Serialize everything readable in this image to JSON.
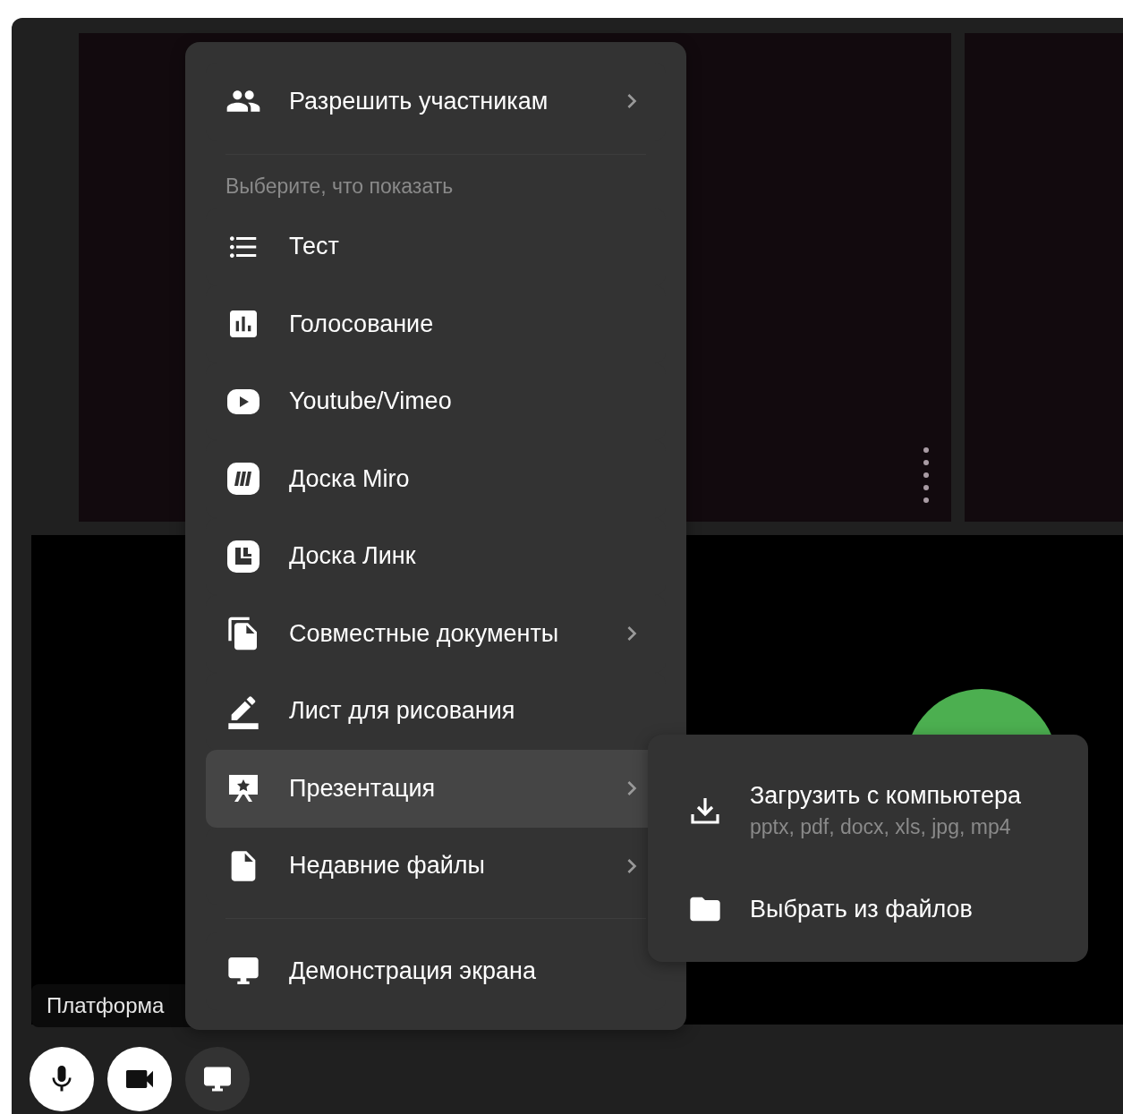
{
  "participants_menu": {
    "label": "Разрешить участникам",
    "has_submenu": true
  },
  "section_title": "Выберите, что показать",
  "items": [
    {
      "kind": "list",
      "label": "Тест",
      "has_submenu": false,
      "selected": false
    },
    {
      "kind": "poll",
      "label": "Голосование",
      "has_submenu": false,
      "selected": false
    },
    {
      "kind": "video",
      "label": "Youtube/Vimeo",
      "has_submenu": false,
      "selected": false
    },
    {
      "kind": "miro",
      "label": "Доска Miro",
      "has_submenu": false,
      "selected": false
    },
    {
      "kind": "board",
      "label": "Доска Линк",
      "has_submenu": false,
      "selected": false
    },
    {
      "kind": "docs",
      "label": "Совместные документы",
      "has_submenu": true,
      "selected": false
    },
    {
      "kind": "pen",
      "label": "Лист для рисования",
      "has_submenu": false,
      "selected": false
    },
    {
      "kind": "presentation",
      "label": "Презентация",
      "has_submenu": true,
      "selected": true
    },
    {
      "kind": "file",
      "label": "Недавние файлы",
      "has_submenu": true,
      "selected": false
    }
  ],
  "screen_share": {
    "label": "Демонстрация экрана"
  },
  "submenu": {
    "items": [
      {
        "kind": "upload",
        "label": "Загрузить с компьютера",
        "hint": "pptx, pdf, docx, xls, jpg, mp4"
      },
      {
        "kind": "folder",
        "label": "Выбрать из файлов"
      }
    ]
  },
  "name_label": "Платформа",
  "controls": [
    {
      "kind": "mic",
      "on": true
    },
    {
      "kind": "camera",
      "on": true
    },
    {
      "kind": "screen",
      "on": false
    }
  ]
}
